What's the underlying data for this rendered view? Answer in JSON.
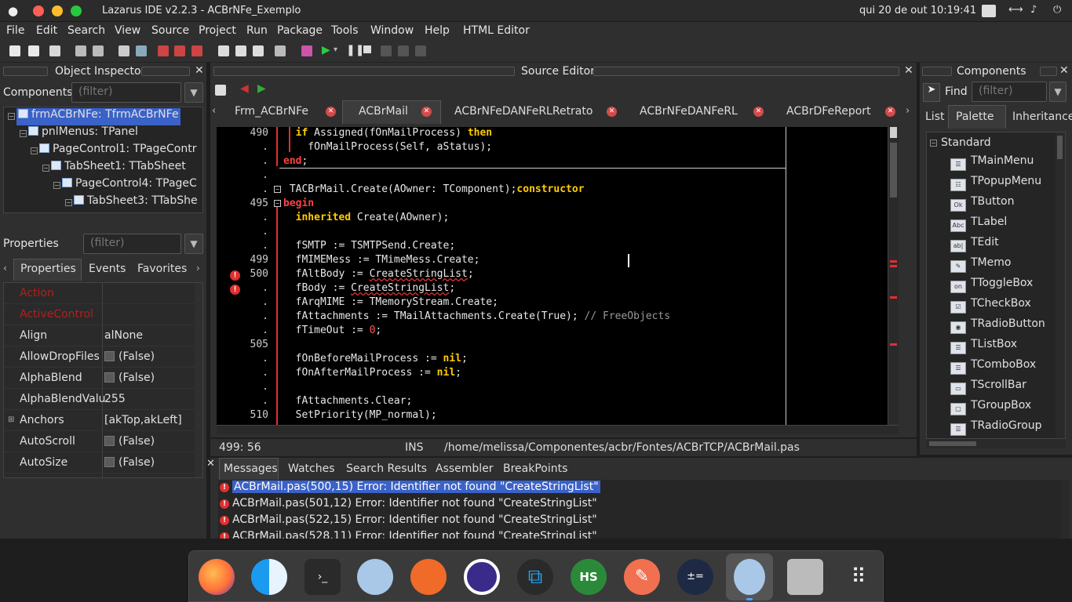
{
  "system": {
    "window_title": "Lazarus IDE v2.2.3 - ACBrNFe_Exemplo",
    "clock": "qui 20 de out  10:19:41"
  },
  "menu": [
    "File",
    "Edit",
    "Search",
    "View",
    "Source",
    "Project",
    "Run",
    "Package",
    "Tools",
    "Window",
    "Help",
    "HTML Editor"
  ],
  "object_inspector": {
    "title": "Object Inspector",
    "components_label": "Components",
    "filter_placeholder": "(filter)",
    "tree": [
      "frmACBrNFe: TfrmACBrNFe",
      "pnlMenus: TPanel",
      "PageControl1: TPageContr",
      "TabSheet1: TTabSheet",
      "PageControl4: TPageC",
      "TabSheet3: TTabShe"
    ],
    "properties_label": "Properties",
    "tabs": [
      "Properties",
      "Events",
      "Favorites"
    ],
    "props": [
      {
        "name": "Action",
        "value": "",
        "red": true
      },
      {
        "name": "ActiveControl",
        "value": "",
        "red": true
      },
      {
        "name": "Align",
        "value": "alNone"
      },
      {
        "name": "AllowDropFiles",
        "value": "(False)",
        "check": true
      },
      {
        "name": "AlphaBlend",
        "value": "(False)",
        "check": true
      },
      {
        "name": "AlphaBlendValu",
        "value": "255"
      },
      {
        "name": "Anchors",
        "value": "[akTop,akLeft]"
      },
      {
        "name": "AutoScroll",
        "value": "(False)",
        "check": true
      },
      {
        "name": "AutoSize",
        "value": "(False)",
        "check": true
      }
    ]
  },
  "source_editor": {
    "title": "Source Editor",
    "tabs": [
      "Frm_ACBrNFe",
      "ACBrMail",
      "ACBrNFeDANFeRLRetrato",
      "ACBrNFeDANFeRL",
      "ACBrDFeReport"
    ],
    "line_numbers": [
      "490",
      ".",
      ".",
      ".",
      ".",
      "495",
      ".",
      ".",
      ".",
      "499",
      "500",
      ".",
      ".",
      ".",
      ".",
      "505",
      ".",
      ".",
      ".",
      ".",
      "510"
    ],
    "status": {
      "pos": "499: 56",
      "mode": "INS",
      "path": "/home/melissa/Componentes/acbr/Fontes/ACBrTCP/ACBrMail.pas"
    }
  },
  "code_lines": [
    {
      "a": "  ",
      "k": "if",
      "b": " Assigned(fOnMailProcess) ",
      "k2": "then"
    },
    {
      "a": "    fOnMailProcess(Self, aStatus);"
    },
    {
      "r": "end",
      "a": ";"
    },
    {
      "a": ""
    },
    {
      "k": "constructor",
      "a": " TACBrMail.Create(AOwner: TComponent);"
    },
    {
      "r": "begin",
      "a": ""
    },
    {
      "a": "  ",
      "k": "inherited",
      "b": " Create(AOwner);"
    },
    {
      "a": ""
    },
    {
      "a": "  fSMTP := TSMTPSend.Create;"
    },
    {
      "a": "  fMIMEMess := TMimeMess.Create;"
    },
    {
      "a": "  fAltBody := ",
      "e": "CreateStringList",
      "b": ";"
    },
    {
      "a": "  fBody := ",
      "e": "CreateStringList",
      "b": ";"
    },
    {
      "a": "  fArqMIME := TMemoryStream.Create;"
    },
    {
      "a": "  fAttachments := TMailAttachments.Create(True); ",
      "c": "// FreeObjects"
    },
    {
      "a": "  fTimeOut := ",
      "n": "0",
      "b": ";"
    },
    {
      "a": ""
    },
    {
      "a": "  fOnBeforeMailProcess := ",
      "k": "nil",
      "b": ";"
    },
    {
      "a": "  fOnAfterMailProcess := ",
      "k": "nil",
      "b": ";"
    },
    {
      "a": ""
    },
    {
      "a": "  fAttachments.Clear;"
    },
    {
      "a": "  SetPriority(MP_normal);"
    }
  ],
  "messages": {
    "tabs": [
      "Messages",
      "Watches",
      "Search Results",
      "Assembler",
      "BreakPoints"
    ],
    "items": [
      "ACBrMail.pas(500,15) Error: Identifier not found \"CreateStringList\"",
      "ACBrMail.pas(501,12) Error: Identifier not found \"CreateStringList\"",
      "ACBrMail.pas(522,15) Error: Identifier not found \"CreateStringList\"",
      "ACBrMail.pas(528,11) Error: Identifier not found \"CreateStringList\""
    ]
  },
  "components": {
    "title": "Components",
    "find_label": "Find",
    "filter_placeholder": "(filter)",
    "tabs": [
      "List",
      "Palette",
      "Inheritance"
    ],
    "category": "Standard",
    "items": [
      "TMainMenu",
      "TPopupMenu",
      "TButton",
      "TLabel",
      "TEdit",
      "TMemo",
      "TToggleBox",
      "TCheckBox",
      "TRadioButton",
      "TListBox",
      "TComboBox",
      "TScrollBar",
      "TGroupBox",
      "TRadioGroup"
    ],
    "icons": [
      "mainmenu-icon",
      "popupmenu-icon",
      "button-icon",
      "label-icon",
      "edit-icon",
      "memo-icon",
      "togglebox-icon",
      "checkbox-icon",
      "radiobutton-icon",
      "listbox-icon",
      "combobox-icon",
      "scrollbar-icon",
      "groupbox-icon",
      "radiogroup-icon"
    ],
    "icon_glyphs": [
      "☰",
      "☷",
      "Ok",
      "Abc",
      "ab|",
      "✎",
      "on",
      "☑",
      "◉",
      "☰",
      "☰",
      "▭",
      "▢",
      "☰"
    ]
  }
}
